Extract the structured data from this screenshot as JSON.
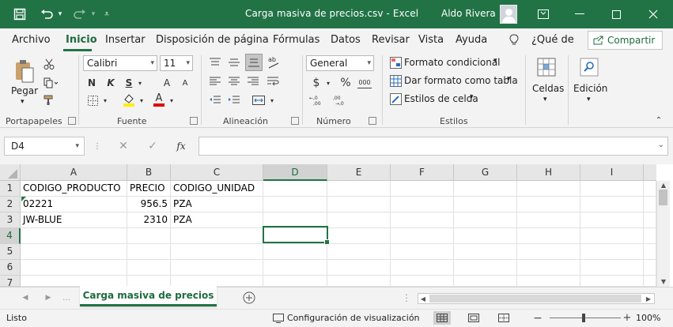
{
  "titlebar": {
    "title": "Carga masiva de precios.csv  -  Excel",
    "user": "Aldo Rivera"
  },
  "ribbon_tabs": [
    "Archivo",
    "Inicio",
    "Insertar",
    "Disposición de página",
    "Fórmulas",
    "Datos",
    "Revisar",
    "Vista",
    "Ayuda"
  ],
  "tell_me": "¿Qué de",
  "share_label": "Compartir",
  "clipboard": {
    "paste_label": "Pegar",
    "group_label": "Portapapeles"
  },
  "font": {
    "name": "Calibri",
    "size": "11",
    "bold": "N",
    "italic": "K",
    "underline": "S",
    "grow": "A",
    "shrink": "A",
    "font_color": "A",
    "group_label": "Fuente"
  },
  "alignment": {
    "group_label": "Alineación"
  },
  "number": {
    "format": "General",
    "currency": "$",
    "percent": "%",
    "comma": "000",
    "group_label": "Número"
  },
  "styles": {
    "conditional": "Formato condicional",
    "as_table": "Dar formato como tabla",
    "cell_styles": "Estilos de celda",
    "group_label": "Estilos"
  },
  "cells_label": "Celdas",
  "editing_label": "Edición",
  "formula_bar": {
    "name_box": "D4",
    "fx": "fx",
    "content": ""
  },
  "columns": [
    "A",
    "B",
    "C",
    "D",
    "E",
    "F",
    "G",
    "H",
    "I"
  ],
  "rows": [
    "1",
    "2",
    "3",
    "4",
    "5",
    "6",
    "7"
  ],
  "cells": [
    [
      "CODIGO_PRODUCTO",
      "PRECIO",
      "CODIGO_UNIDAD"
    ],
    [
      "02221",
      "956.5",
      "PZA"
    ],
    [
      "JW-BLUE",
      "2310",
      "PZA"
    ]
  ],
  "sheet_tab": "Carga masiva de precios",
  "status": {
    "ready": "Listo",
    "display_settings": "Configuración de visualización",
    "zoom": "100%"
  },
  "colors": {
    "accent": "#217346"
  }
}
